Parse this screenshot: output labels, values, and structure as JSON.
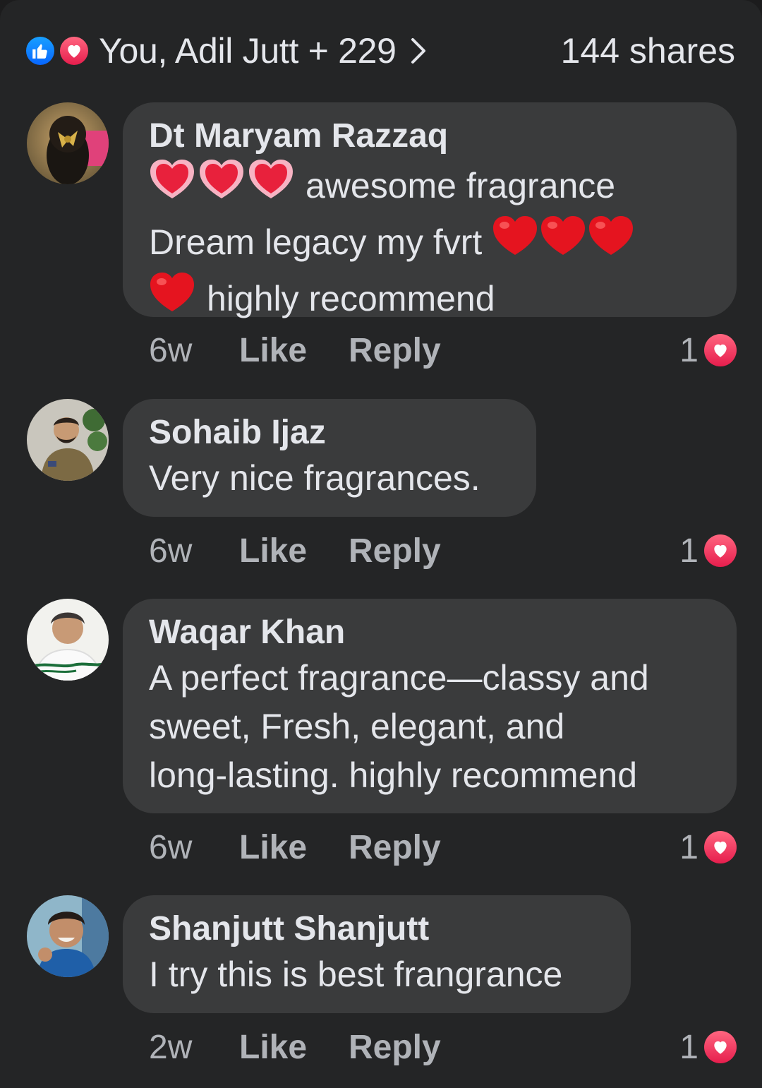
{
  "header": {
    "reactors": "You, Adil Jutt + 229",
    "shares": "144 shares",
    "reaction_icons": [
      "like-icon",
      "love-icon"
    ],
    "colors": {
      "like": "#0866ff",
      "love": "#e61e4d",
      "bubble": "#3a3b3c",
      "background": "#242526"
    }
  },
  "comments": [
    {
      "author": "Dt Maryam Razzaq",
      "lines": [
        "awesome fragrance",
        "Dream legacy my fvrt",
        "highly recommend"
      ],
      "emojis": [
        "sparkling-heart-icon",
        "red-heart-icon"
      ],
      "time": "6w",
      "like_label": "Like",
      "reply_label": "Reply",
      "reaction_count": "1"
    },
    {
      "author": "Sohaib Ijaz",
      "lines": [
        "Very nice fragrances."
      ],
      "time": "6w",
      "like_label": "Like",
      "reply_label": "Reply",
      "reaction_count": "1"
    },
    {
      "author": "Waqar Khan",
      "lines": [
        "A perfect fragrance—classy and",
        "sweet, Fresh, elegant, and",
        "long-lasting. highly recommend"
      ],
      "time": "6w",
      "like_label": "Like",
      "reply_label": "Reply",
      "reaction_count": "1"
    },
    {
      "author": "Shanjutt Shanjutt",
      "lines": [
        "I try this is best frangrance"
      ],
      "time": "2w",
      "like_label": "Like",
      "reply_label": "Reply",
      "reaction_count": "1"
    }
  ]
}
